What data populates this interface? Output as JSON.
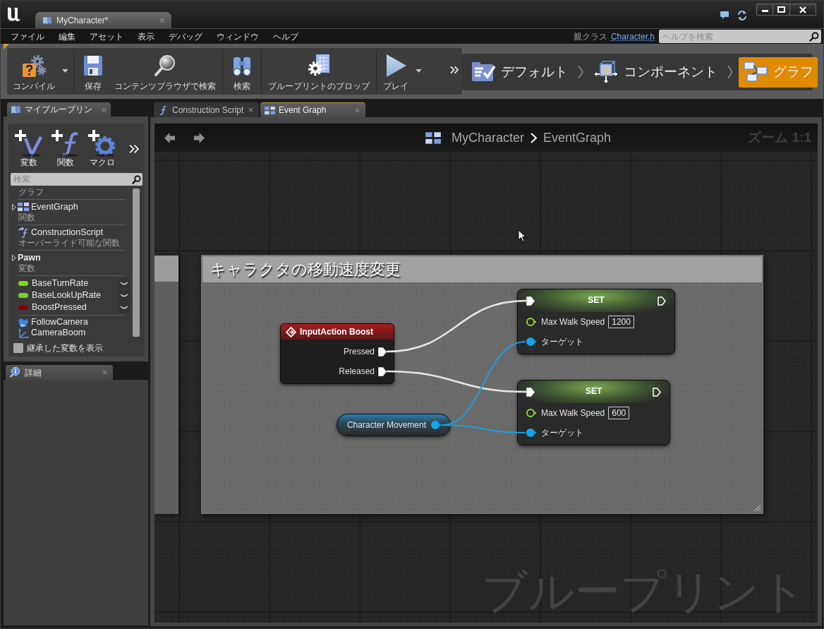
{
  "window": {
    "document_tab": "MyCharacter*"
  },
  "menu_bar": {
    "items": [
      "ファイル",
      "編集",
      "アセット",
      "表示",
      "デバッグ",
      "ウィンドウ",
      "ヘルプ"
    ],
    "parent_class_label": "親クラス",
    "parent_class_link": "Character.h",
    "help_search": {
      "placeholder": "ヘルプを検索"
    }
  },
  "toolbar": {
    "buttons": [
      {
        "kind": "compile",
        "label": "コンパイル",
        "dropdown": true
      },
      {
        "kind": "save",
        "label": "保存",
        "dropdown": false
      },
      {
        "kind": "browse",
        "label": "コンテンツブラウザで検索",
        "dropdown": false
      },
      {
        "kind": "find",
        "label": "検索",
        "dropdown": false
      },
      {
        "kind": "props",
        "label": "ブループリントのプロップ",
        "dropdown": false
      },
      {
        "kind": "play",
        "label": "プレイ",
        "dropdown": true
      }
    ]
  },
  "mode_bar": {
    "modes": [
      {
        "kind": "defaults",
        "label": "デフォルト",
        "selected": false
      },
      {
        "kind": "components",
        "label": "コンポーネント",
        "selected": false
      },
      {
        "kind": "graph",
        "label": "グラフ",
        "selected": true
      }
    ]
  },
  "my_blueprint": {
    "tab": "マイブループリン",
    "add_buttons": [
      {
        "kind": "variable",
        "label": "変数"
      },
      {
        "kind": "function",
        "label": "関数"
      },
      {
        "kind": "macro",
        "label": "マクロ"
      }
    ],
    "search": {
      "placeholder": "検索"
    },
    "rows": [
      {
        "kind": "header",
        "label": "グラフ"
      },
      {
        "kind": "graph",
        "label": "EventGraph",
        "expanded": false
      },
      {
        "kind": "header",
        "label": "関数"
      },
      {
        "kind": "function",
        "label": "ConstructionScript"
      },
      {
        "kind": "header",
        "label": "オーバーライド可能な関数"
      },
      {
        "kind": "category",
        "label": "Pawn",
        "expanded": false
      },
      {
        "kind": "header",
        "label": "変数"
      },
      {
        "kind": "variable",
        "label": "BaseTurnRate",
        "color": "#7ed321"
      },
      {
        "kind": "variable",
        "label": "BaseLookUpRate",
        "color": "#7ed321"
      },
      {
        "kind": "variable",
        "label": "BoostPressed",
        "color": "#8b0000"
      },
      {
        "kind": "component",
        "label": "FollowCamera"
      },
      {
        "kind": "component",
        "label": "CameraBoom"
      }
    ],
    "show_inherited": {
      "label": "継承した変数を表示",
      "checked": false
    }
  },
  "details": {
    "tab": "詳細"
  },
  "graph_tabs": [
    {
      "kind": "function",
      "label": "Construction Script",
      "selected": false
    },
    {
      "kind": "graph",
      "label": "Event Graph",
      "selected": true
    }
  ],
  "graph": {
    "breadcrumb": [
      "MyCharacter",
      "EventGraph"
    ],
    "zoom": "ズーム 1:1",
    "comment": "キャラクタの移動速度変更",
    "nodes": [
      {
        "kind": "event",
        "title": "InputAction Boost",
        "pins": [
          {
            "label": "Pressed",
            "kind": "exec",
            "linked": true
          },
          {
            "label": "Released",
            "kind": "exec",
            "linked": true
          }
        ]
      },
      {
        "kind": "getter",
        "title": "Character Movement",
        "pin": {
          "kind": "object",
          "linked": true
        }
      },
      {
        "kind": "set",
        "title": "SET",
        "exec_in": {
          "linked": true
        },
        "exec_out": {
          "linked": false
        },
        "pins": [
          {
            "label": "Max Walk Speed",
            "kind": "float",
            "linked": false,
            "value": "1200"
          },
          {
            "label": "ターゲット",
            "kind": "object",
            "linked": true
          }
        ]
      },
      {
        "kind": "set",
        "title": "SET",
        "exec_in": {
          "linked": true
        },
        "exec_out": {
          "linked": false
        },
        "pins": [
          {
            "label": "Max Walk Speed",
            "kind": "float",
            "linked": false,
            "value": "600"
          },
          {
            "label": "ターゲット",
            "kind": "object",
            "linked": true
          }
        ]
      }
    ],
    "corner_label": "ブループリント"
  }
}
